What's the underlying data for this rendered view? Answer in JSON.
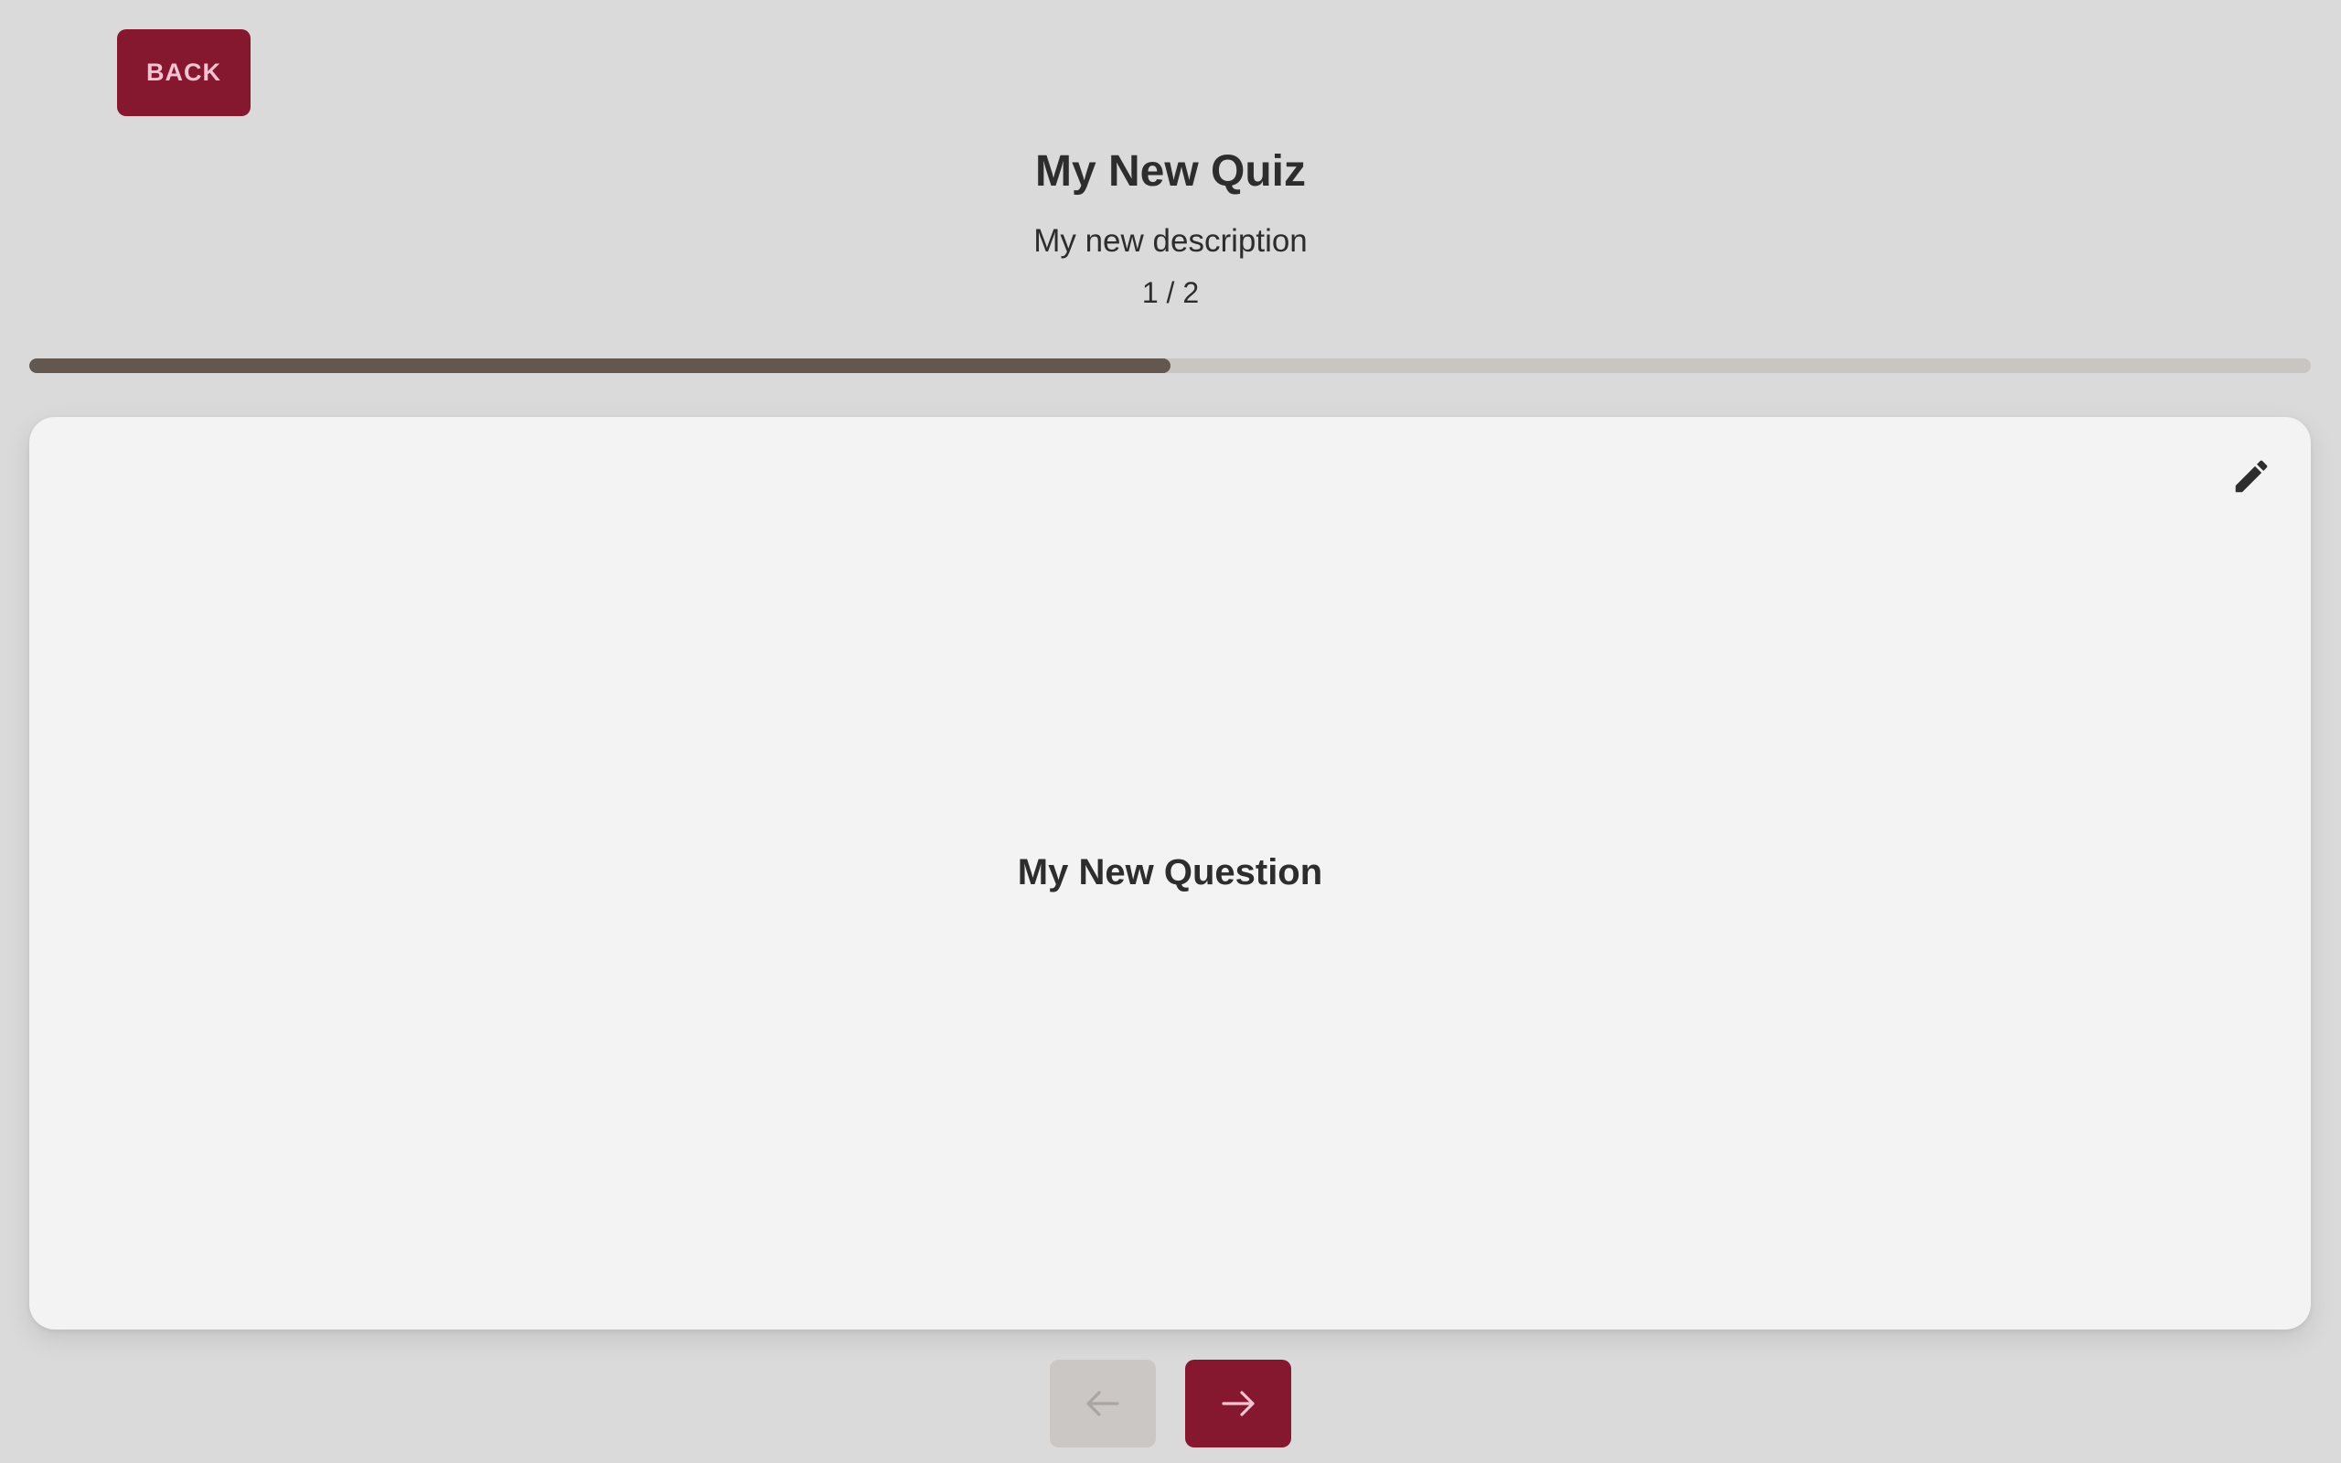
{
  "header": {
    "back_label": "BACK"
  },
  "quiz": {
    "title": "My New Quiz",
    "description": "My new description",
    "counter": "1 / 2",
    "current": 1,
    "total": 2,
    "progress_fraction": 0.5
  },
  "card": {
    "question": "My New Question",
    "edit_icon": "pencil-icon"
  },
  "nav": {
    "prev_icon": "arrow-left-icon",
    "prev_enabled": false,
    "next_icon": "arrow-right-icon",
    "next_enabled": true
  },
  "colors": {
    "accent": "#85182f",
    "accent_text": "#f3c3cf",
    "background": "#dadada",
    "card": "#f3f3f3",
    "progress_fill": "#635850",
    "progress_track": "#c9c5c1",
    "disabled_button": "#cbc7c4"
  }
}
